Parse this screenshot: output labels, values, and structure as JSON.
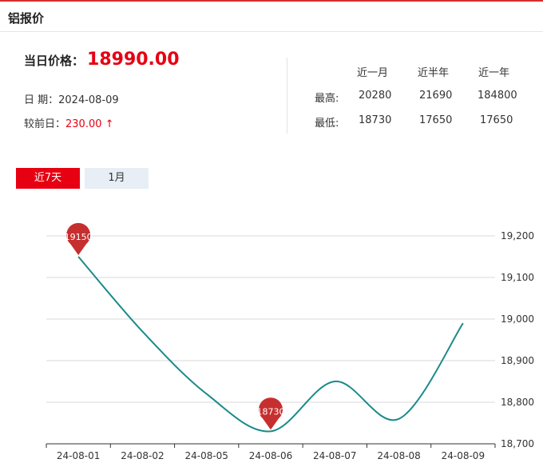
{
  "header": {
    "title": "铝报价"
  },
  "price": {
    "label": "当日价格：",
    "value": "18990.00",
    "date_label": "日  期：",
    "date": "2024-08-09",
    "change_label": "较前日：",
    "change": "230.00",
    "arrow": "↑"
  },
  "stats": {
    "columns": [
      "近一月",
      "近半年",
      "近一年"
    ],
    "rows": [
      {
        "label": "最高:",
        "values": [
          "20280",
          "21690",
          "184800"
        ]
      },
      {
        "label": "最低:",
        "values": [
          "18730",
          "17650",
          "17650"
        ]
      }
    ]
  },
  "tabs": [
    {
      "label": "近7天",
      "active": true
    },
    {
      "label": "1月",
      "active": false
    }
  ],
  "colors": {
    "accent": "#e60012",
    "line": "#1a8a8a",
    "marker": "#c62f2f"
  },
  "chart_data": {
    "type": "line",
    "x": [
      "24-08-01",
      "24-08-02",
      "24-08-05",
      "24-08-06",
      "24-08-07",
      "24-08-08",
      "24-08-09"
    ],
    "series": [
      {
        "values": [
          19150,
          18970,
          18820,
          18730,
          18850,
          18760,
          18990
        ]
      }
    ],
    "markers": [
      {
        "index": 0,
        "label": "19150"
      },
      {
        "index": 3,
        "label": "18730"
      }
    ],
    "yticks": [
      "19,200",
      "19,100",
      "19,000",
      "18,900",
      "18,800",
      "18,700"
    ],
    "ylim": [
      18700,
      19200
    ],
    "grid": true,
    "smooth": true
  }
}
